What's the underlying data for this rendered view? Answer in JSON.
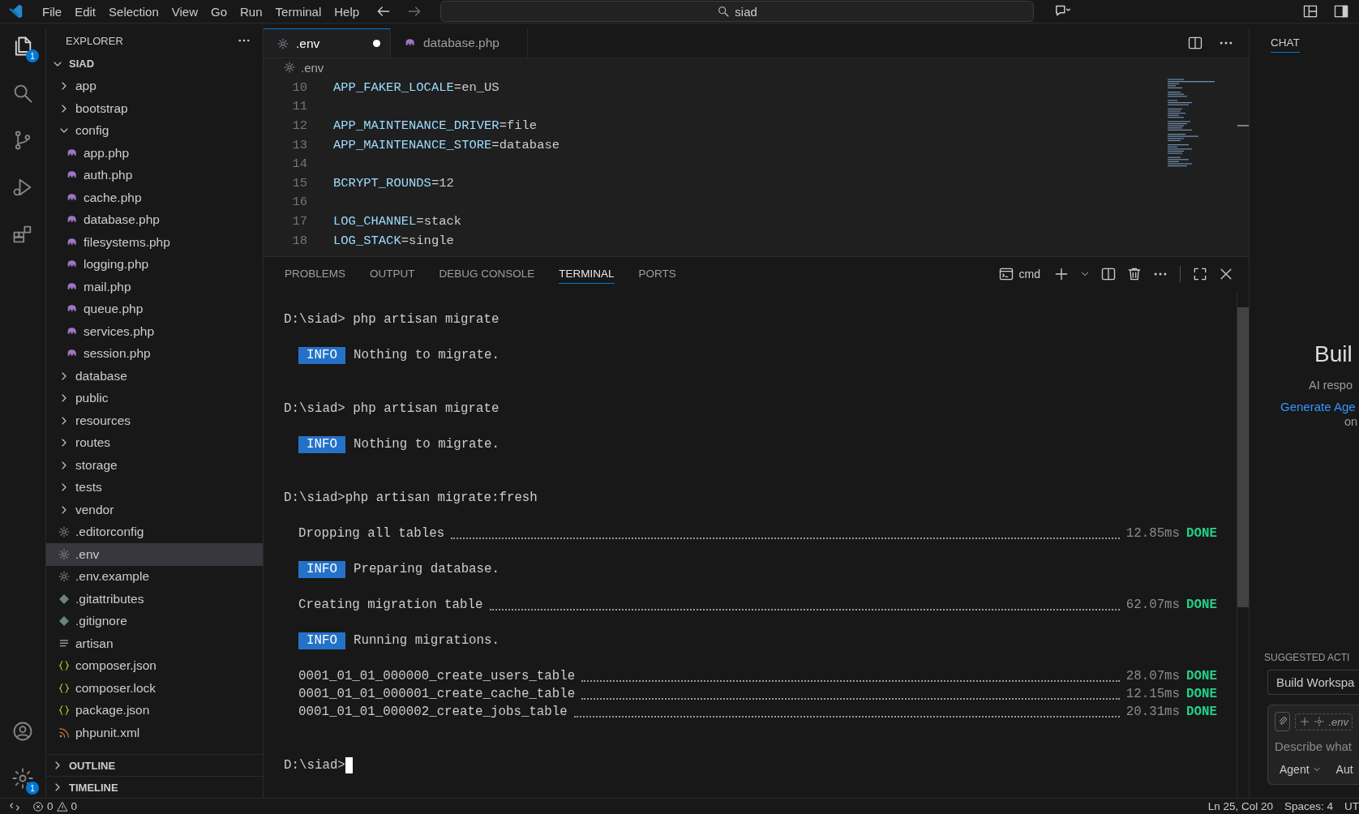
{
  "menu": [
    "File",
    "Edit",
    "Selection",
    "View",
    "Go",
    "Run",
    "Terminal",
    "Help"
  ],
  "search": {
    "value": "siad"
  },
  "activity": [
    {
      "kind": "explorer",
      "selected": true,
      "badge": "1"
    },
    {
      "kind": "search",
      "selected": false
    },
    {
      "kind": "source-control",
      "selected": false
    },
    {
      "kind": "run",
      "selected": false
    },
    {
      "kind": "extensions",
      "selected": false
    }
  ],
  "activity_bottom": [
    {
      "kind": "account"
    },
    {
      "kind": "settings",
      "badge": "1"
    }
  ],
  "sidebar": {
    "title": "EXPLORER",
    "root": "SIAD",
    "items": [
      {
        "label": "app",
        "kind": "folder",
        "expanded": false,
        "selected": false
      },
      {
        "label": "bootstrap",
        "kind": "folder",
        "expanded": false,
        "selected": false
      },
      {
        "label": "config",
        "kind": "folder",
        "expanded": true,
        "selected": false,
        "children": [
          {
            "label": "app.php",
            "kind": "php",
            "selected": false
          },
          {
            "label": "auth.php",
            "kind": "php",
            "selected": false
          },
          {
            "label": "cache.php",
            "kind": "php",
            "selected": false
          },
          {
            "label": "database.php",
            "kind": "php",
            "selected": false
          },
          {
            "label": "filesystems.php",
            "kind": "php",
            "selected": false
          },
          {
            "label": "logging.php",
            "kind": "php",
            "selected": false
          },
          {
            "label": "mail.php",
            "kind": "php",
            "selected": false
          },
          {
            "label": "queue.php",
            "kind": "php",
            "selected": false
          },
          {
            "label": "services.php",
            "kind": "php",
            "selected": false
          },
          {
            "label": "session.php",
            "kind": "php",
            "selected": false
          }
        ]
      },
      {
        "label": "database",
        "kind": "folder",
        "expanded": false,
        "selected": false
      },
      {
        "label": "public",
        "kind": "folder",
        "expanded": false,
        "selected": false
      },
      {
        "label": "resources",
        "kind": "folder",
        "expanded": false,
        "selected": false
      },
      {
        "label": "routes",
        "kind": "folder",
        "expanded": false,
        "selected": false
      },
      {
        "label": "storage",
        "kind": "folder",
        "expanded": false,
        "selected": false
      },
      {
        "label": "tests",
        "kind": "folder",
        "expanded": false,
        "selected": false
      },
      {
        "label": "vendor",
        "kind": "folder",
        "expanded": false,
        "selected": false
      },
      {
        "label": ".editorconfig",
        "kind": "config",
        "selected": false
      },
      {
        "label": ".env",
        "kind": "config",
        "selected": true
      },
      {
        "label": ".env.example",
        "kind": "config",
        "selected": false
      },
      {
        "label": ".gitattributes",
        "kind": "git",
        "selected": false
      },
      {
        "label": ".gitignore",
        "kind": "git",
        "selected": false
      },
      {
        "label": "artisan",
        "kind": "text",
        "selected": false
      },
      {
        "label": "composer.json",
        "kind": "json",
        "selected": false
      },
      {
        "label": "composer.lock",
        "kind": "json",
        "selected": false
      },
      {
        "label": "package.json",
        "kind": "json",
        "selected": false
      },
      {
        "label": "phpunit.xml",
        "kind": "xml",
        "selected": false
      }
    ],
    "sections": [
      {
        "label": "OUTLINE",
        "expanded": false
      },
      {
        "label": "TIMELINE",
        "expanded": false
      }
    ]
  },
  "tabs": [
    {
      "label": ".env",
      "kind": "config",
      "selected": true,
      "modified": true
    },
    {
      "label": "database.php",
      "kind": "php",
      "selected": false,
      "modified": false
    }
  ],
  "breadcrumb": {
    "label": ".env",
    "kind": "config"
  },
  "code": [
    {
      "n": "10",
      "key": "APP_FAKER_LOCALE",
      "value": "=en_US"
    },
    {
      "n": "11"
    },
    {
      "n": "12",
      "key": "APP_MAINTENANCE_DRIVER",
      "value": "=file"
    },
    {
      "n": "13",
      "key": "APP_MAINTENANCE_STORE",
      "value": "=database"
    },
    {
      "n": "14"
    },
    {
      "n": "15",
      "key": "BCRYPT_ROUNDS",
      "value": "=12"
    },
    {
      "n": "16"
    },
    {
      "n": "17",
      "key": "LOG_CHANNEL",
      "value": "=stack"
    },
    {
      "n": "18",
      "key": "LOG_STACK",
      "value": "=single"
    }
  ],
  "panel_tabs": [
    {
      "label": "PROBLEMS",
      "selected": false
    },
    {
      "label": "OUTPUT",
      "selected": false
    },
    {
      "label": "DEBUG CONSOLE",
      "selected": false
    },
    {
      "label": "TERMINAL",
      "selected": true
    },
    {
      "label": "PORTS",
      "selected": false
    }
  ],
  "terminal_name": "cmd",
  "terminal": [
    {
      "kind": "prompt",
      "text": "D:\\siad> php artisan migrate"
    },
    {
      "kind": "blank"
    },
    {
      "kind": "info",
      "tag": "INFO",
      "text": "Nothing to migrate."
    },
    {
      "kind": "blank"
    },
    {
      "kind": "blank"
    },
    {
      "kind": "prompt",
      "text": "D:\\siad> php artisan migrate"
    },
    {
      "kind": "blank"
    },
    {
      "kind": "info",
      "tag": "INFO",
      "text": "Nothing to migrate."
    },
    {
      "kind": "blank"
    },
    {
      "kind": "blank"
    },
    {
      "kind": "prompt",
      "text": "D:\\siad>php artisan migrate:fresh"
    },
    {
      "kind": "blank"
    },
    {
      "kind": "task",
      "text": "Dropping all tables",
      "time": "12.85ms",
      "status": "DONE"
    },
    {
      "kind": "blank"
    },
    {
      "kind": "info",
      "tag": "INFO",
      "text": "Preparing database."
    },
    {
      "kind": "blank"
    },
    {
      "kind": "task",
      "text": "Creating migration table",
      "time": "62.07ms",
      "status": "DONE"
    },
    {
      "kind": "blank"
    },
    {
      "kind": "info",
      "tag": "INFO",
      "text": "Running migrations."
    },
    {
      "kind": "blank"
    },
    {
      "kind": "task",
      "text": "0001_01_01_000000_create_users_table",
      "time": "28.07ms",
      "status": "DONE"
    },
    {
      "kind": "task",
      "text": "0001_01_01_000001_create_cache_table",
      "time": "12.15ms",
      "status": "DONE"
    },
    {
      "kind": "task",
      "text": "0001_01_01_000002_create_jobs_table",
      "time": "20.31ms",
      "status": "DONE"
    },
    {
      "kind": "blank"
    },
    {
      "kind": "blank"
    },
    {
      "kind": "cursor",
      "text": "D:\\siad>"
    }
  ],
  "chat": {
    "tab": "CHAT",
    "heading": "Buil",
    "line1": "AI respo",
    "link": "Generate Age",
    "line2": "on",
    "suggested_title": "SUGGESTED ACTI",
    "suggested": "Build Workspa",
    "context": ".env",
    "placeholder": "Describe what",
    "mode": "Agent",
    "model": "Aut"
  },
  "status_bar": {
    "errors": "0",
    "warnings": "0",
    "position": "Ln 25, Col 20",
    "spaces": "Spaces: 4",
    "encoding": "UT"
  }
}
